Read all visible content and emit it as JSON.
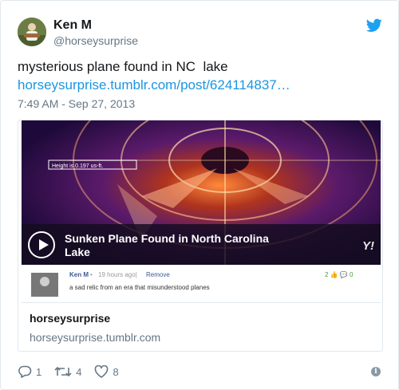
{
  "author": {
    "name": "Ken M",
    "handle": "@horseysurprise"
  },
  "tweet": {
    "text": "mysterious plane found in NC  lake",
    "link": "horseysurprise.tumblr.com/post/624114837…",
    "timestamp": "7:49 AM - Sep 27, 2013"
  },
  "card": {
    "video_title": "Sunken Plane Found in North Carolina Lake",
    "image_caption": "Height is 0.197 us-ft.",
    "brand_logo": "Y!",
    "comment": {
      "author": "Ken M",
      "dot": "•",
      "time": "19 hours ago|",
      "remove": "Remove",
      "body": "a sad relic from an era that misunderstood planes",
      "meta": "2 👍 💬 0"
    },
    "title": "horseysurprise",
    "domain": "horseysurprise.tumblr.com"
  },
  "actions": {
    "replies": "1",
    "retweets": "4",
    "likes": "8"
  },
  "icons": {
    "bird": "twitter-bird-icon",
    "info": "info-icon",
    "play": "play-icon"
  },
  "colors": {
    "brand": "#1da1f2",
    "link": "#1b95e0",
    "muted": "#657786"
  }
}
